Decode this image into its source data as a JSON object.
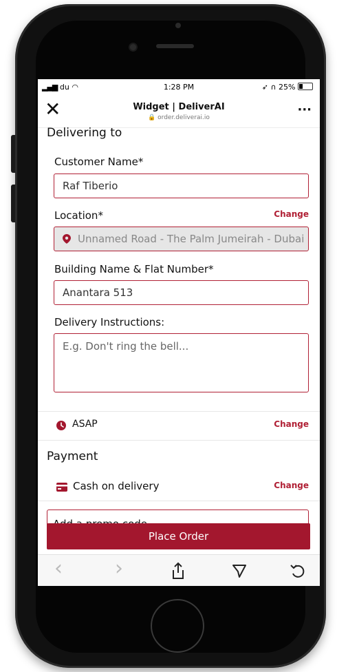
{
  "status": {
    "carrier": "du",
    "time": "1:28 PM",
    "battery": "25%"
  },
  "browser": {
    "title": "Widget | DeliverAI",
    "url": "order.deliverai.io",
    "close_icon": "close-icon",
    "more_icon": "more-icon"
  },
  "form": {
    "section_title": "Delivering to",
    "name_label": "Customer Name*",
    "name_value": "Raf Tiberio",
    "location_label": "Location*",
    "location_change": "Change",
    "location_value": "Unnamed Road - The Palm Jumeirah - Dubai",
    "building_label": "Building Name & Flat Number*",
    "building_value": "Anantara 513",
    "instructions_label": "Delivery Instructions:",
    "instructions_placeholder": "E.g. Don't ring the bell..."
  },
  "time": {
    "label": "ASAP",
    "change": "Change",
    "icon": "clock-icon"
  },
  "payment": {
    "title": "Payment",
    "method": "Cash on delivery",
    "change": "Change",
    "icon": "card-icon"
  },
  "promo": {
    "text": "Add a promo code"
  },
  "cta": {
    "label": "Place Order"
  },
  "toolbar": {
    "back": "‹",
    "forward": "›"
  },
  "colors": {
    "accent": "#a3172e"
  }
}
